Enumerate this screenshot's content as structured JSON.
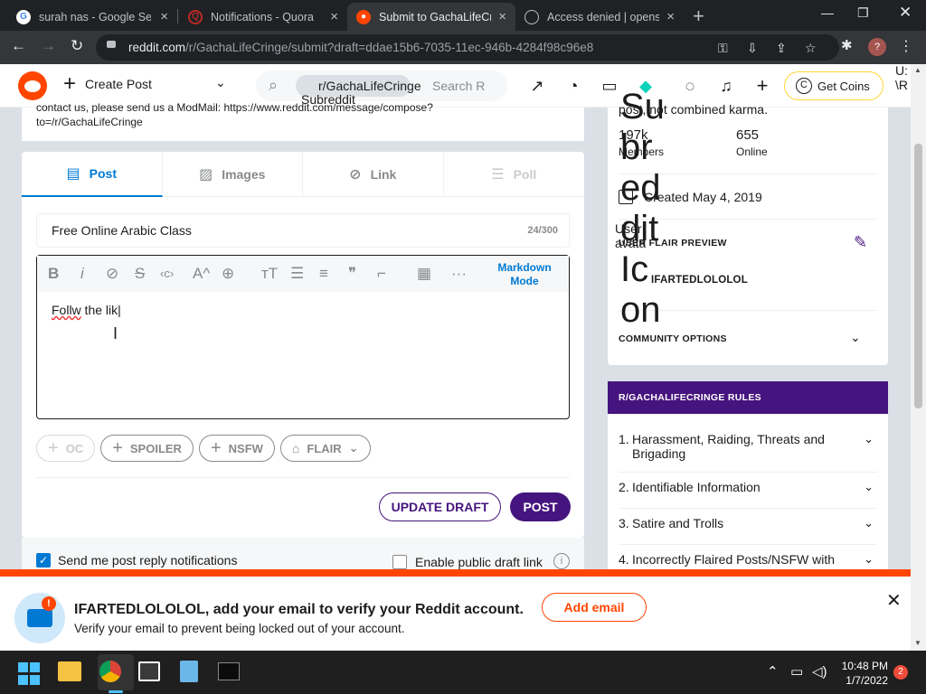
{
  "browser": {
    "tabs": [
      {
        "title": "surah nas - Google Sea",
        "icon": "google-icon"
      },
      {
        "title": "Notifications - Quora",
        "icon": "quora-icon"
      },
      {
        "title": "Submit to GachaLifeCri",
        "icon": "reddit-icon",
        "active": true
      },
      {
        "title": "Access denied | opense",
        "icon": "globe-icon"
      }
    ],
    "url_host": "reddit.com",
    "url_path": "/r/GachaLifeCringe/submit?draft=ddae15b6-7035-11ec-946b-4284f98c96e8",
    "profile_initial": "?"
  },
  "header": {
    "create_post": "Create Post",
    "search_subreddit": "r/GachaLifeCringe",
    "search_placeholder": "Search R",
    "subreddit_icon_alt": "Subreddit Icon",
    "coins": "Get Coins",
    "user_alt_fragment": "U: \\R"
  },
  "notice": {
    "line1": "contact us, please send us a ModMail: https://www.reddit.com/message/compose?",
    "line2": "to=/r/GachaLifeCringe"
  },
  "post": {
    "tabs": [
      "Post",
      "Images",
      "Link",
      "Poll"
    ],
    "title_value": "Free Online Arabic Class",
    "title_count": "24/300",
    "body_text_misspelled": "Follw",
    "body_text_rest": " the lik",
    "markdown_mode": "Markdown Mode",
    "chips": [
      "OC",
      "SPOILER",
      "NSFW",
      "FLAIR"
    ],
    "update_draft": "UPDATE DRAFT",
    "post_button": "POST",
    "reply_notifications": "Send me post reply notifications",
    "public_draft": "Enable public draft link"
  },
  "sidebar": {
    "about_tail": "post, not combined karma.",
    "members_value": "197k",
    "members_label": "Members",
    "online_value": "655",
    "online_label": "Online",
    "created": "Created May 4, 2019",
    "flair_preview": "USER FLAIR PREVIEW",
    "flair_user": "IFARTEDLOLOLOL",
    "user_avatar_alt": "User avatar",
    "community_options": "COMMUNITY OPTIONS",
    "overlay_alt": "Subreddit Icon",
    "rules_header": "R/GACHALIFECRINGE RULES",
    "rules": [
      {
        "num": "1.",
        "text": "Harassment, Raiding, Threats and Brigading"
      },
      {
        "num": "2.",
        "text": "Identifiable Information"
      },
      {
        "num": "3.",
        "text": "Satire and Trolls"
      },
      {
        "num": "4.",
        "text": "Incorrectly Flaired Posts/NSFW with"
      }
    ]
  },
  "banner": {
    "title": "IFARTEDLOLOLOL, add your email to verify your Reddit account.",
    "subtitle": "Verify your email to prevent being locked out of your account.",
    "button": "Add email"
  },
  "taskbar": {
    "time": "10:48 PM",
    "date": "1/7/2022",
    "notifications": "2"
  },
  "colors": {
    "reddit_orange": "#ff4500",
    "subreddit_purple": "#46147e",
    "link_blue": "#0079d3"
  }
}
